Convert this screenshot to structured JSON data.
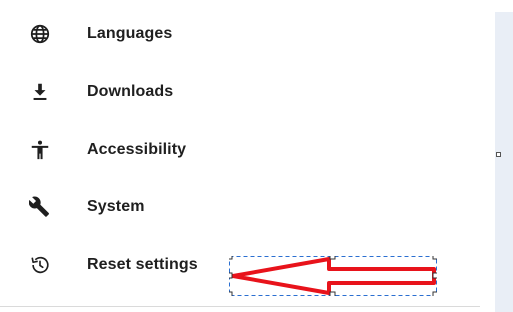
{
  "settings_menu": {
    "items": [
      {
        "label": "Languages",
        "icon": "globe-icon"
      },
      {
        "label": "Downloads",
        "icon": "download-icon"
      },
      {
        "label": "Accessibility",
        "icon": "accessibility-icon"
      },
      {
        "label": "System",
        "icon": "wrench-icon"
      },
      {
        "label": "Reset settings",
        "icon": "reset-history-icon"
      }
    ]
  },
  "colors": {
    "text": "#1f1f1f",
    "icon": "#1f1f1f",
    "scrollbar_track": "#e9eef6",
    "annotation_arrow": "#e8131b",
    "annotation_selection": "#2b6fd1"
  }
}
